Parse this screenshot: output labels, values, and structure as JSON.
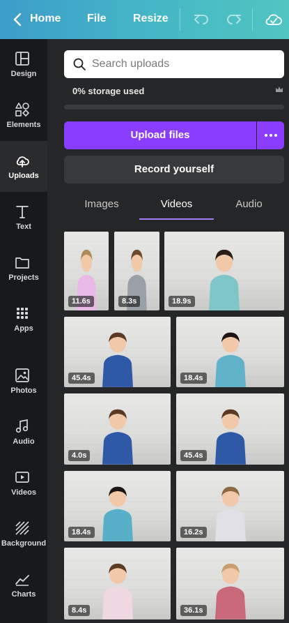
{
  "header": {
    "back_icon": "chevron-left-icon",
    "home_label": "Home",
    "file_label": "File",
    "resize_label": "Resize",
    "undo_icon": "undo-icon",
    "redo_icon": "redo-icon",
    "cloud_icon": "cloud-check-icon"
  },
  "sidebar": {
    "items": [
      {
        "label": "Design",
        "icon": "layout-icon"
      },
      {
        "label": "Elements",
        "icon": "shapes-icon"
      },
      {
        "label": "Uploads",
        "icon": "cloud-upload-icon",
        "active": true
      },
      {
        "label": "Text",
        "icon": "text-icon"
      },
      {
        "label": "Projects",
        "icon": "folder-icon"
      },
      {
        "label": "Apps",
        "icon": "apps-grid-icon"
      },
      {
        "label": "Photos",
        "icon": "photo-icon"
      },
      {
        "label": "Audio",
        "icon": "music-note-icon"
      },
      {
        "label": "Videos",
        "icon": "video-icon"
      },
      {
        "label": "Background",
        "icon": "hatch-icon"
      },
      {
        "label": "Charts",
        "icon": "chart-icon"
      }
    ]
  },
  "uploads": {
    "search_placeholder": "Search uploads",
    "storage_label": "0% storage used",
    "storage_percent": 0,
    "upload_button": "Upload files",
    "record_button": "Record yourself",
    "tabs": [
      {
        "label": "Images"
      },
      {
        "label": "Videos",
        "active": true
      },
      {
        "label": "Audio"
      }
    ],
    "videos": [
      {
        "duration": "11.6s"
      },
      {
        "duration": "8.3s"
      },
      {
        "duration": "18.9s"
      },
      {
        "duration": "45.4s"
      },
      {
        "duration": "18.4s"
      },
      {
        "duration": "4.0s"
      },
      {
        "duration": "45.4s"
      },
      {
        "duration": "18.4s"
      },
      {
        "duration": "16.2s"
      },
      {
        "duration": "8.4s"
      },
      {
        "duration": "36.1s"
      }
    ]
  },
  "colors": {
    "accent": "#8b3dff",
    "header_gradient_start": "#3d9cc9",
    "header_gradient_end": "#52c4c1",
    "panel_bg": "#252627",
    "rail_bg": "#18191b"
  }
}
